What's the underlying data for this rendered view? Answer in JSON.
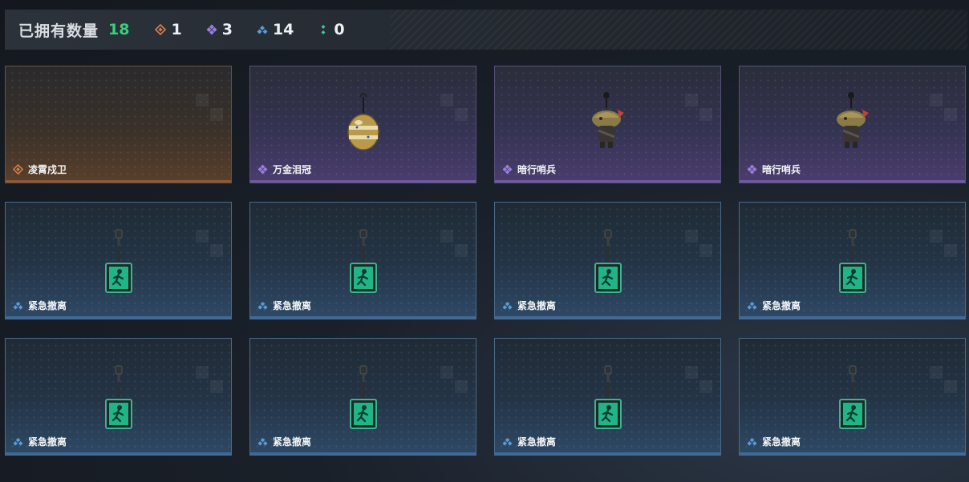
{
  "header": {
    "owned_label": "已拥有数量",
    "owned_count": "18",
    "rarity_counts": [
      {
        "rarity": "orange",
        "icon": "orange-diamond-icon",
        "color": "#d9804a",
        "count": "1"
      },
      {
        "rarity": "purple",
        "icon": "purple-diamond-icon",
        "color": "#9b7de0",
        "count": "3"
      },
      {
        "rarity": "blue",
        "icon": "blue-diamond-icon",
        "color": "#5a9ad8",
        "count": "14"
      },
      {
        "rarity": "green",
        "icon": "green-diamond-icon",
        "color": "#35c8a0",
        "count": "0"
      }
    ]
  },
  "items": [
    {
      "name": "凌霄戍卫",
      "rarity": "orange",
      "image": "empty"
    },
    {
      "name": "万金泪冠",
      "rarity": "purple",
      "image": "gold-bauble-charm"
    },
    {
      "name": "暗行哨兵",
      "rarity": "purple",
      "image": "sentinel-charm"
    },
    {
      "name": "暗行哨兵",
      "rarity": "purple",
      "image": "sentinel-charm"
    },
    {
      "name": "紧急撤离",
      "rarity": "blue",
      "image": "exit-sign-charm"
    },
    {
      "name": "紧急撤离",
      "rarity": "blue",
      "image": "exit-sign-charm"
    },
    {
      "name": "紧急撤离",
      "rarity": "blue",
      "image": "exit-sign-charm"
    },
    {
      "name": "紧急撤离",
      "rarity": "blue",
      "image": "exit-sign-charm"
    },
    {
      "name": "紧急撤离",
      "rarity": "blue",
      "image": "exit-sign-charm"
    },
    {
      "name": "紧急撤离",
      "rarity": "blue",
      "image": "exit-sign-charm"
    },
    {
      "name": "紧急撤离",
      "rarity": "blue",
      "image": "exit-sign-charm"
    },
    {
      "name": "紧急撤离",
      "rarity": "blue",
      "image": "exit-sign-charm"
    }
  ]
}
